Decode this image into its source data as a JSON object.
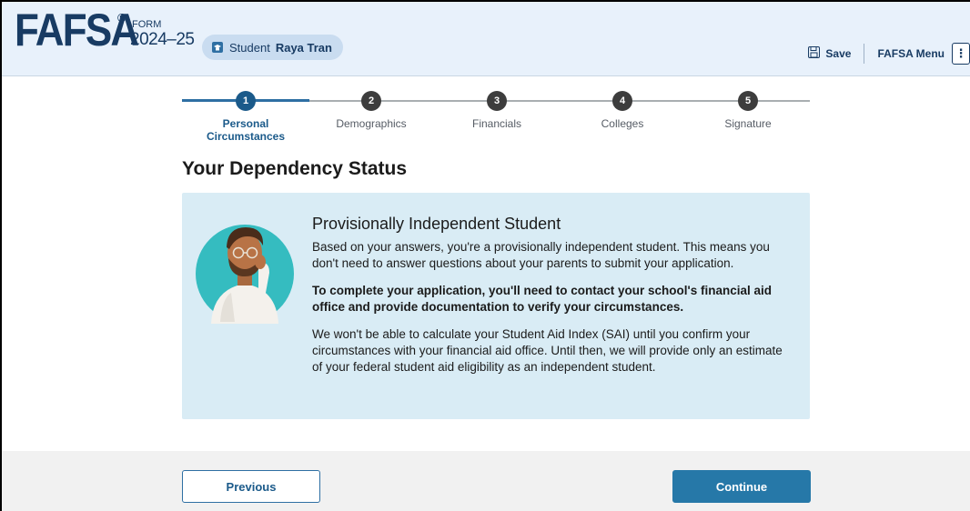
{
  "header": {
    "logo": "FAFSA",
    "logo_mark": "®",
    "form_label": "FORM",
    "form_year": "2024–25",
    "student_role": "Student",
    "student_name": "Raya Tran",
    "save_label": "Save",
    "menu_label": "FAFSA Menu",
    "menu_icon": "⋮"
  },
  "stepper": {
    "steps": [
      {
        "number": "1",
        "label": "Personal Circumstances"
      },
      {
        "number": "2",
        "label": "Demographics"
      },
      {
        "number": "3",
        "label": "Financials"
      },
      {
        "number": "4",
        "label": "Colleges"
      },
      {
        "number": "5",
        "label": "Signature"
      }
    ],
    "current_step": 1
  },
  "page": {
    "title": "Your Dependency Status"
  },
  "alert": {
    "title": "Provisionally Independent Student",
    "p1": "Based on your answers, you're a provisionally independent student. This means you don't need to answer questions about your parents to submit your application.",
    "p2": "To complete your application, you'll need to contact your school's financial aid office and provide documentation to verify your circumstances.",
    "p3": "We won't be able to calculate your Student Aid Index (SAI) until you confirm your circumstances with your financial aid office. Until then, we will provide only an estimate of your federal student aid eligibility as an independent student."
  },
  "footer": {
    "previous_label": "Previous",
    "continue_label": "Continue"
  },
  "colors": {
    "brand": "#183b63",
    "header_bg": "#e8f1fb",
    "accent": "#1b5a8a",
    "alert_bg": "#d9ecf5",
    "primary_button": "#2678a8"
  },
  "icons": {
    "student": "graduation-cap-icon",
    "save": "floppy-disk-icon",
    "menu": "kebab-menu-icon"
  }
}
